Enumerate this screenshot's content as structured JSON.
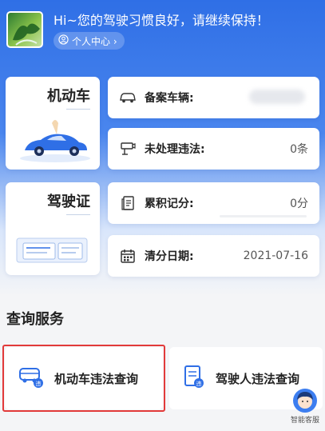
{
  "header": {
    "greeting": "Hi~您的驾驶习惯良好，请继续保持！",
    "profile_link": "个人中心 ›"
  },
  "vehicle_card": {
    "title": "机动车"
  },
  "license_card": {
    "title": "驾驶证"
  },
  "info_rows": [
    {
      "label": "备案车辆:",
      "value": "",
      "icon": "car-icon"
    },
    {
      "label": "未处理违法:",
      "value": "0条",
      "icon": "camera-icon"
    },
    {
      "label": "累积记分:",
      "value": "0分",
      "icon": "document-icon"
    },
    {
      "label": "清分日期:",
      "value": "2021-07-16",
      "icon": "calendar-icon"
    }
  ],
  "services": {
    "section_title": "查询服务",
    "items": [
      {
        "label": "机动车违法查询",
        "icon": "car-query-icon"
      },
      {
        "label": "驾驶人违法查询",
        "icon": "document-query-icon"
      }
    ]
  },
  "customer_service": {
    "label": "智能客服"
  },
  "colors": {
    "primary": "#2f6fe6",
    "highlight": "#e23a3a",
    "accent": "#3d7ef0"
  }
}
